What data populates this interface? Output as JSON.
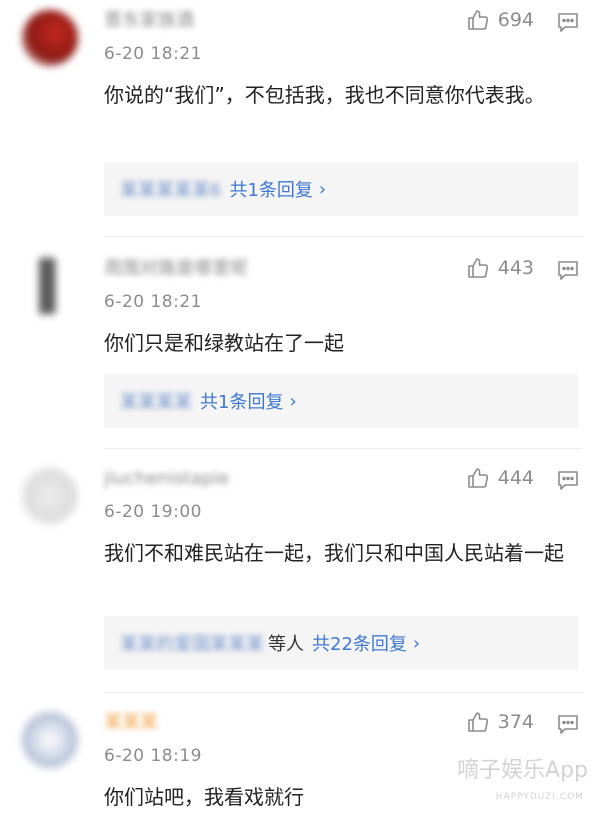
{
  "comments": [
    {
      "username": "晋东家族酒",
      "time": "6-20 18:21",
      "likes": "694",
      "text": "你说的“我们”，不包括我，我也不同意你代表我。",
      "reply_names": "某某某某某6",
      "reply_names_suffix": "",
      "reply_count": "共1条回复",
      "avatar_color": "#b3231c"
    },
    {
      "username": "周围对路是哪里呢",
      "time": "6-20 18:21",
      "likes": "443",
      "text": "你们只是和绿教站在了一起",
      "reply_names": "某某某某",
      "reply_names_suffix": "",
      "reply_count": "共1条回复",
      "avatar_color": "#555555"
    },
    {
      "username": "jiuchenistapie",
      "time": "6-20 19:00",
      "likes": "444",
      "text": "我们不和难民站在一起，我们只和中国人民站着一起",
      "reply_names": "某某的爱国某某某",
      "reply_names_suffix": "等人",
      "reply_count": "共22条回复",
      "avatar_color": "#d9d9d9"
    },
    {
      "username": "某某某",
      "time": "6-20 18:19",
      "likes": "374",
      "text": "你们站吧，我看戏就行",
      "reply_names": "",
      "reply_names_suffix": "",
      "reply_count": "",
      "avatar_color": "#9aa9c4"
    }
  ],
  "watermark": {
    "main": "嘀子娱乐App",
    "sub": "HAPPYDUZI.COM"
  },
  "colors": {
    "link_blue": "#3f78d1",
    "meta_gray": "#8c8c8c",
    "reply_bg": "#f5f5f5"
  },
  "icons": [
    "thumbs-up-icon",
    "comment-reply-icon",
    "chevron-right-icon"
  ]
}
